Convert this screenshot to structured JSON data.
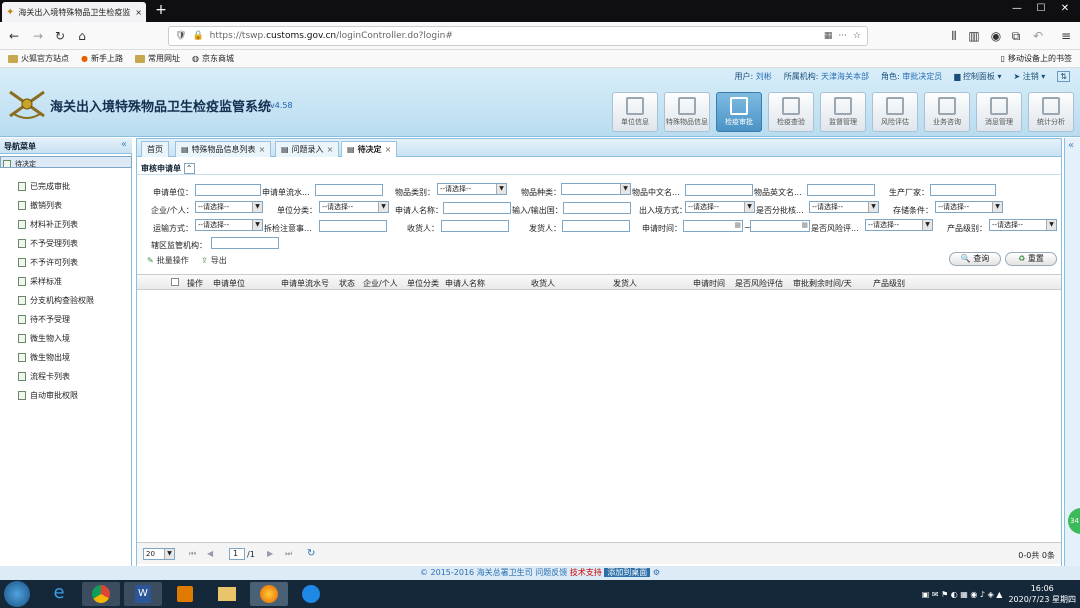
{
  "browser": {
    "tab_title": "海关出入境特殊物品卫生检疫监管",
    "tab_close": "×",
    "new_tab": "+",
    "url_prefix": "https://tswp.",
    "url_domain": "customs.gov.cn",
    "url_path": "/loginController.do?login#",
    "bookmarks": [
      "火狐官方站点",
      "新手上路",
      "常用网址",
      "京东商城"
    ],
    "mobile_bookmarks": "移动设备上的书签"
  },
  "app": {
    "user_label": "用户:",
    "user_name": "刘彬",
    "org_label": "所属机构:",
    "org_name": "天津海关本部",
    "role_label": "角色:",
    "role_name": "审批决定员",
    "control_panel": "控制面板",
    "logout": "注销",
    "title": "海关出入境特殊物品卫生检疫监管系统",
    "version": "v4.58",
    "toolbar": [
      "单位信息",
      "特殊物品信息",
      "检疫审批",
      "检疫查验",
      "监督管理",
      "风险评估",
      "业务咨询",
      "消息管理",
      "统计分析"
    ]
  },
  "sidebar": {
    "title": "导航菜单",
    "items": [
      "待决定",
      "已完成审批",
      "撤销列表",
      "材料补正列表",
      "不予受理列表",
      "不予许可列表",
      "采样标准",
      "分支机构查验权限",
      "待不予受理",
      "微生物入境",
      "微生物出境",
      "流程卡列表",
      "自动审批权限"
    ]
  },
  "tabs": [
    {
      "label": "首页"
    },
    {
      "label": "特殊物品信息列表",
      "close": "×"
    },
    {
      "label": "问题录入",
      "close": "×"
    },
    {
      "label": "待决定",
      "close": "×"
    }
  ],
  "form": {
    "section_title": "审核申请单",
    "select_placeholder": "--请选择--",
    "labels": {
      "applicant_unit": "申请单位：",
      "serial_no": "申请单流水...",
      "item_category": "物品类别：",
      "item_type": "物品种类：",
      "cn_name": "物品中文名...",
      "en_name": "物品英文名...",
      "manufacturer": "生产厂家：",
      "company_person": "企业/个人：",
      "unit_category": "单位分类：",
      "applicant_name": "申请人名称：",
      "io_country": "输入/输出国：",
      "io_method": "出入境方式：",
      "batch_check": "是否分批核...",
      "storage": "存储条件：",
      "transport": "运输方式：",
      "notes": "拆检注意事...",
      "consignee": "收货人：",
      "consignor": "发货人：",
      "apply_time": "申请时间：",
      "time_sep": "~",
      "risk_eval": "是否风险评...",
      "product_level": "产品级别：",
      "jurisdiction": "辖区监管机构："
    },
    "batch_op": "批量操作",
    "export": "导出",
    "query": "查询",
    "reset": "重置"
  },
  "grid": {
    "columns": [
      "操作",
      "申请单位",
      "申请单流水号",
      "状态",
      "企业/个人",
      "单位分类",
      "申请人名称",
      "收货人",
      "发货人",
      "申请时间",
      "是否风险评估",
      "审批剩余时间/天",
      "产品级别"
    ]
  },
  "pager": {
    "page_size": "20",
    "page": "1",
    "total_pages": "/1",
    "summary": "0-0共 0条"
  },
  "footer": {
    "copyright": "© 2015-2016 海关总署卫生司",
    "feedback": "问题反馈",
    "tech": "技术支持",
    "add_desktop": "添加到桌面"
  },
  "taskbar": {
    "time": "16:06",
    "date": "2020/7/23 星期四"
  },
  "side_badge": "34"
}
